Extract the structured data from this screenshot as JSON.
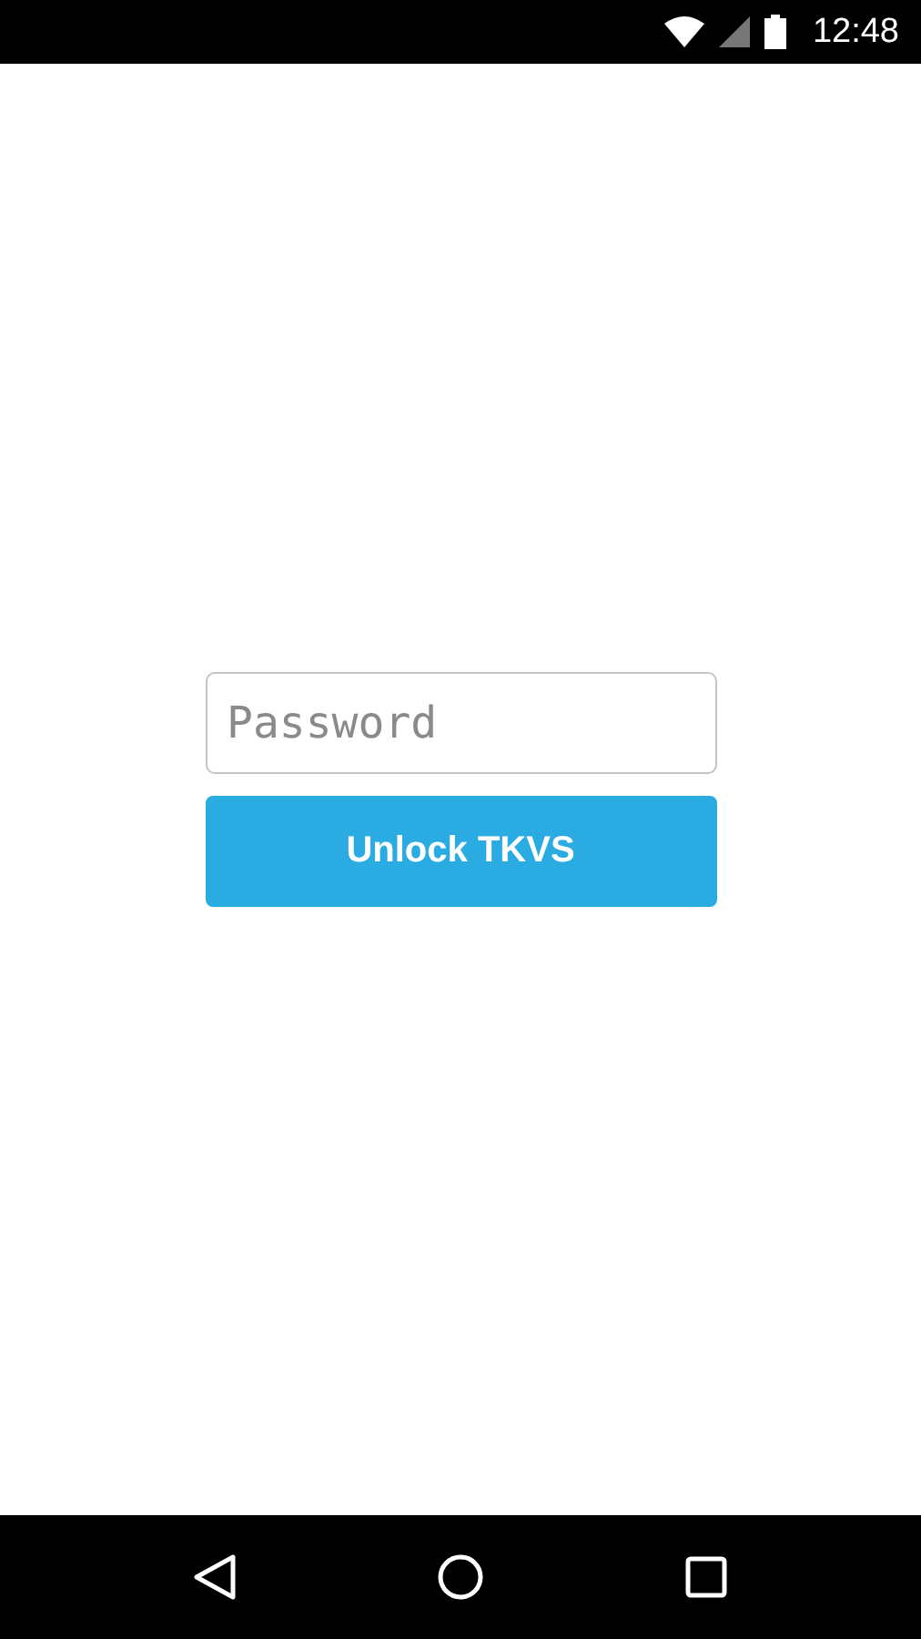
{
  "status_bar": {
    "time": "12:48"
  },
  "password_field": {
    "placeholder": "Password"
  },
  "unlock_button": {
    "label": "Unlock TKVS"
  }
}
